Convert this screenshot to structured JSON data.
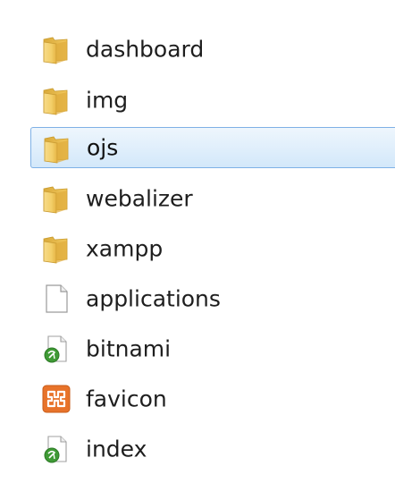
{
  "files": [
    {
      "name": "dashboard",
      "type": "folder",
      "icon": "folder-icon"
    },
    {
      "name": "img",
      "type": "folder",
      "icon": "folder-icon"
    },
    {
      "name": "ojs",
      "type": "folder",
      "icon": "folder-icon",
      "selected": true
    },
    {
      "name": "webalizer",
      "type": "folder",
      "icon": "folder-icon"
    },
    {
      "name": "xampp",
      "type": "folder",
      "icon": "folder-icon"
    },
    {
      "name": "applications",
      "type": "file",
      "icon": "blank-file-icon"
    },
    {
      "name": "bitnami",
      "type": "file",
      "icon": "web-document-icon"
    },
    {
      "name": "favicon",
      "type": "file",
      "icon": "xampp-icon"
    },
    {
      "name": "index",
      "type": "file",
      "icon": "web-document-icon"
    }
  ],
  "colors": {
    "selection_border": "#7fb1e6",
    "selection_fill": "#d3e8fa",
    "folder_yellow": "#f2cf63",
    "xampp_orange": "#e8732a",
    "web_green": "#3f9a35"
  }
}
